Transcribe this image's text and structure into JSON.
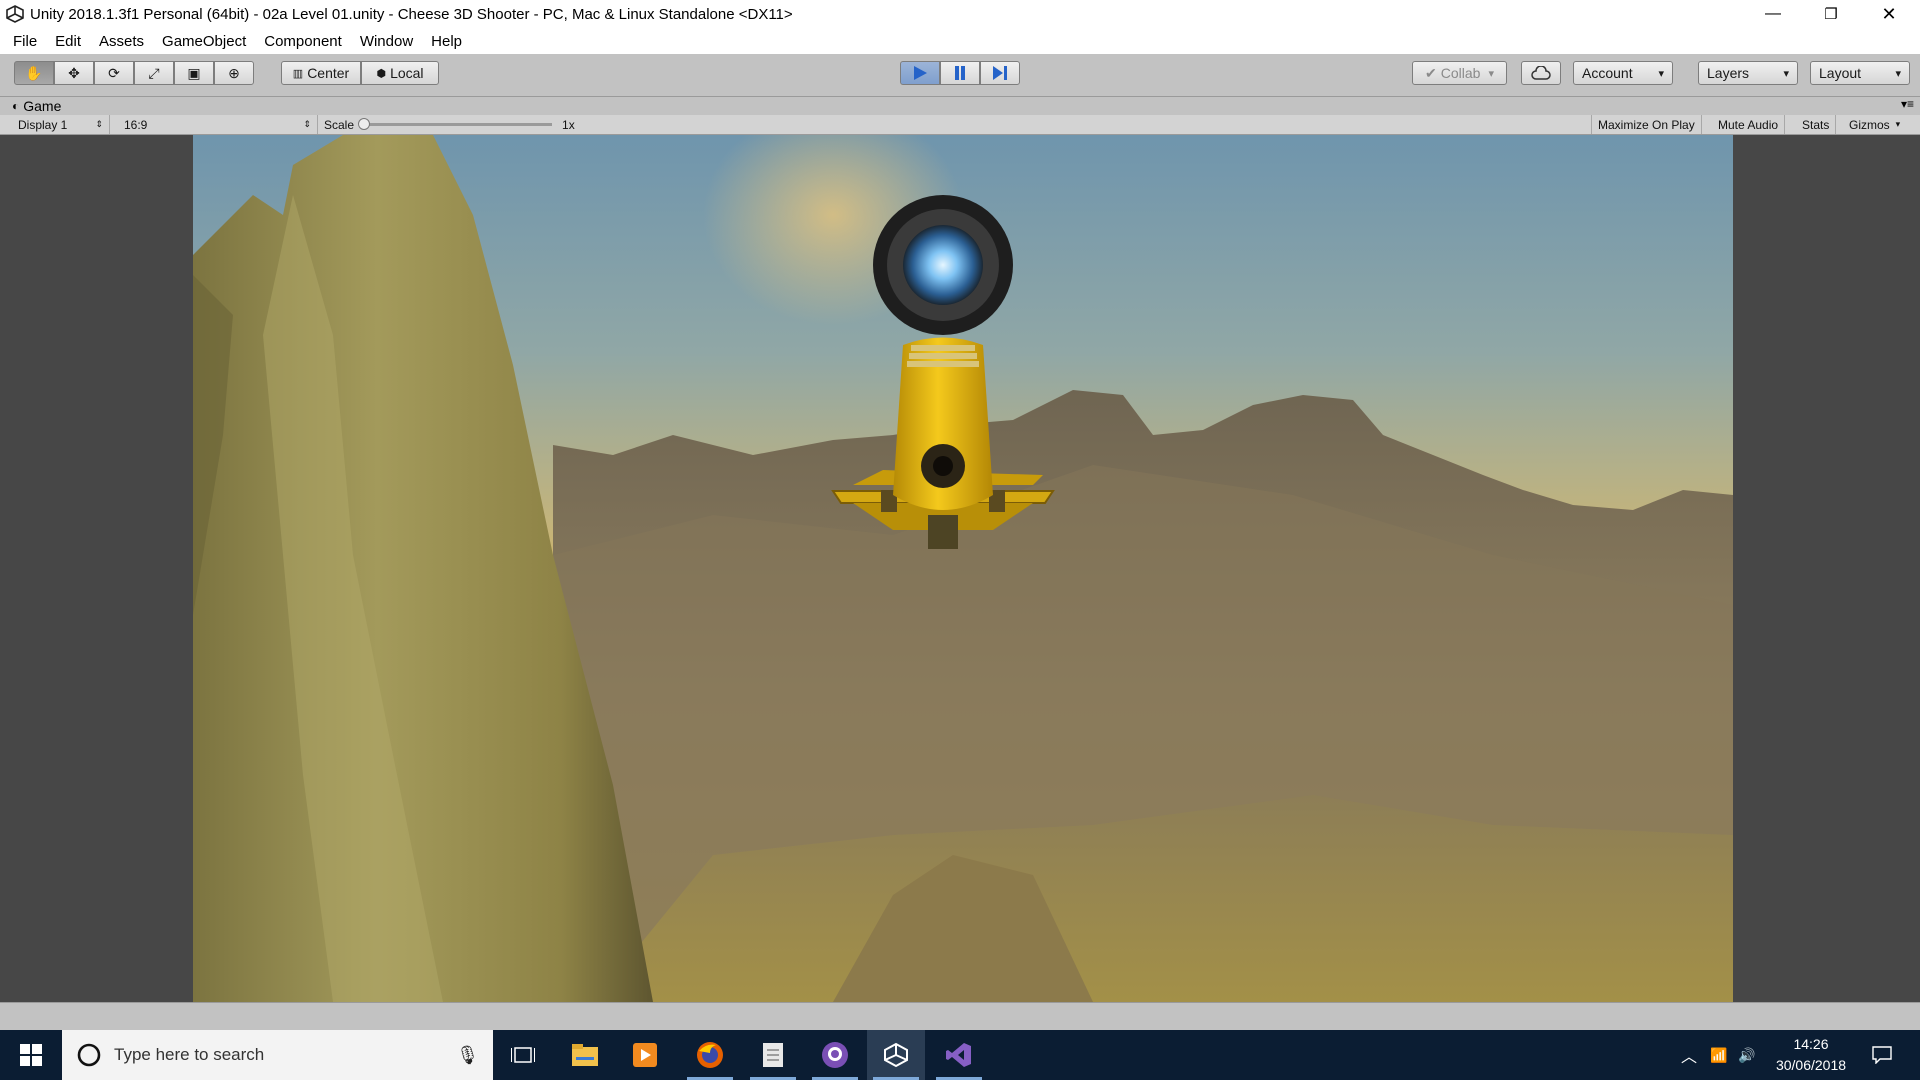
{
  "window": {
    "title": "Unity 2018.1.3f1 Personal (64bit) - 02a Level 01.unity - Cheese 3D Shooter - PC, Mac & Linux Standalone <DX11>",
    "controls": [
      "minimize-icon",
      "restore-icon",
      "close-icon"
    ]
  },
  "menu": {
    "items": [
      "File",
      "Edit",
      "Assets",
      "GameObject",
      "Component",
      "Window",
      "Help"
    ]
  },
  "toolbar": {
    "tools": [
      "hand-icon",
      "move-icon",
      "rotate-icon",
      "scale-icon",
      "rect-tool-icon",
      "transform-icon"
    ],
    "active_tool": "hand-icon",
    "pivot_label": "Center",
    "space_label": "Local",
    "play_state": "playing",
    "collab_label": "Collab",
    "account_label": "Account",
    "layers_label": "Layers",
    "layout_label": "Layout"
  },
  "game_tab": {
    "label": "Game",
    "display": "Display 1",
    "aspect": "16:9",
    "scale_label": "Scale",
    "scale_value": "1x",
    "maximize_label": "Maximize On Play",
    "mute_label": "Mute Audio",
    "stats_label": "Stats",
    "gizmos_label": "Gizmos"
  },
  "taskbar": {
    "search_placeholder": "Type here to search",
    "apps": [
      "task-view-icon",
      "file-explorer-icon",
      "media-player-icon",
      "firefox-icon",
      "notes-icon",
      "github-icon",
      "unity-icon",
      "visual-studio-icon"
    ],
    "time": "14:26",
    "date": "30/06/2018"
  },
  "colors": {
    "editor_gray": "#c2c2c2",
    "play_blue": "#4a7fd1",
    "taskbar": "#0b1d33",
    "ship_yellow": "#f2c316"
  }
}
